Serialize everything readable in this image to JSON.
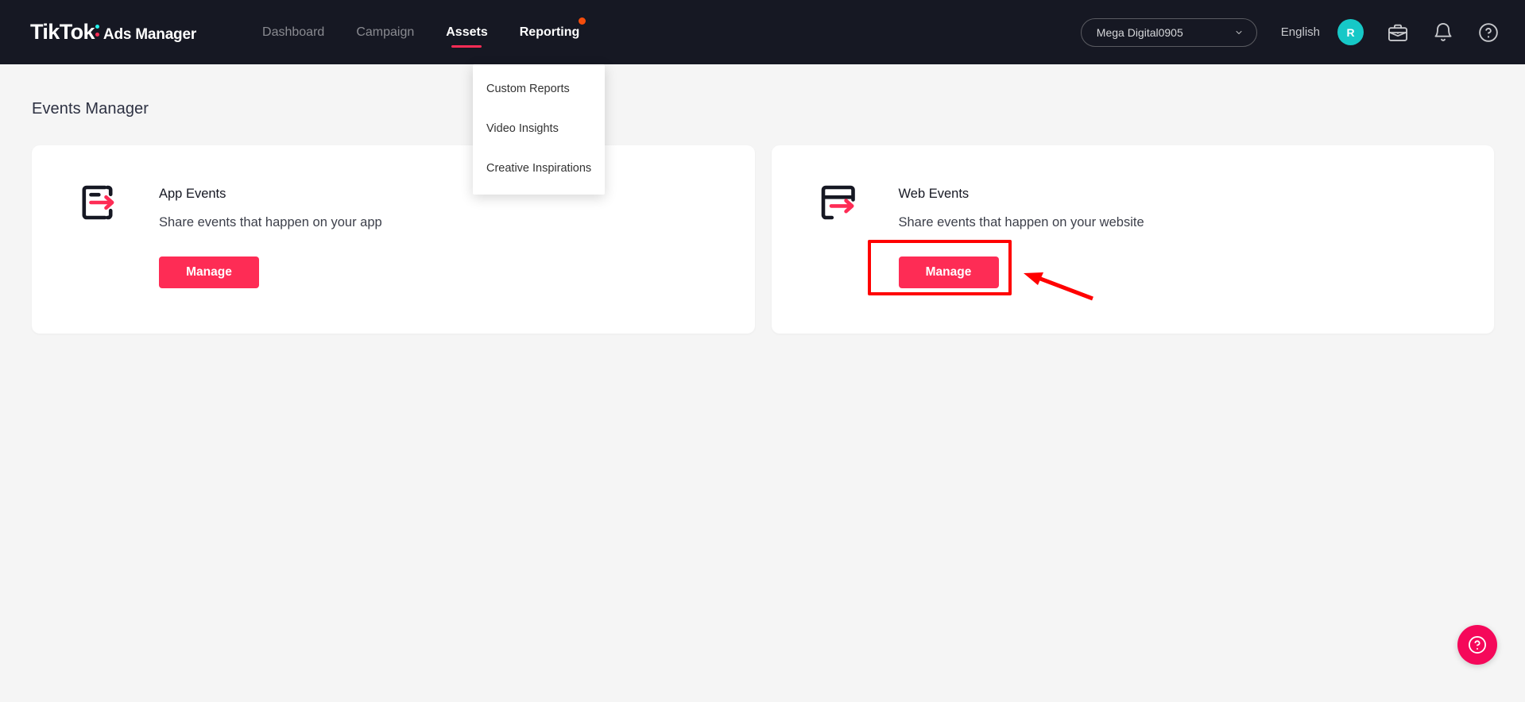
{
  "topbar": {
    "logo": {
      "brand": "TikTok",
      "product": "Ads Manager",
      "colon_icon": "tiktok-colon-icon"
    },
    "nav": [
      {
        "label": "Dashboard",
        "active": false,
        "hovered": false,
        "badge": false
      },
      {
        "label": "Campaign",
        "active": false,
        "hovered": false,
        "badge": false
      },
      {
        "label": "Assets",
        "active": true,
        "hovered": false,
        "badge": false
      },
      {
        "label": "Reporting",
        "active": false,
        "hovered": true,
        "badge": true
      }
    ],
    "account_selector": {
      "value": "Mega Digital0905",
      "icon": "chevron-down-icon"
    },
    "language": "English",
    "avatar": {
      "initial": "R",
      "color": "#16c8c7"
    },
    "icons": [
      "briefcase-icon",
      "bell-icon",
      "help-circle-icon"
    ]
  },
  "dropdown": {
    "parent": "Reporting",
    "items": [
      {
        "label": "Custom Reports"
      },
      {
        "label": "Video Insights"
      },
      {
        "label": "Creative Inspirations"
      }
    ]
  },
  "page": {
    "title": "Events Manager",
    "cards": [
      {
        "icon": "app-events-icon",
        "title": "App Events",
        "description": "Share events that happen on your app",
        "button": "Manage",
        "highlighted": false
      },
      {
        "icon": "web-events-icon",
        "title": "Web Events",
        "description": "Share events that happen on your website",
        "button": "Manage",
        "highlighted": true
      }
    ]
  },
  "annotation": {
    "box_color": "#ff0000",
    "arrow_color": "#ff0000",
    "target": "Manage"
  },
  "fab": {
    "icon": "help-circle-icon",
    "color": "#f5085a"
  },
  "colors": {
    "nav_background": "#161823",
    "page_background": "#f5f5f5",
    "accent_pink": "#fe2c55",
    "badge_orange": "#f54d0c",
    "avatar_teal": "#16c8c7",
    "card_background": "#ffffff"
  }
}
